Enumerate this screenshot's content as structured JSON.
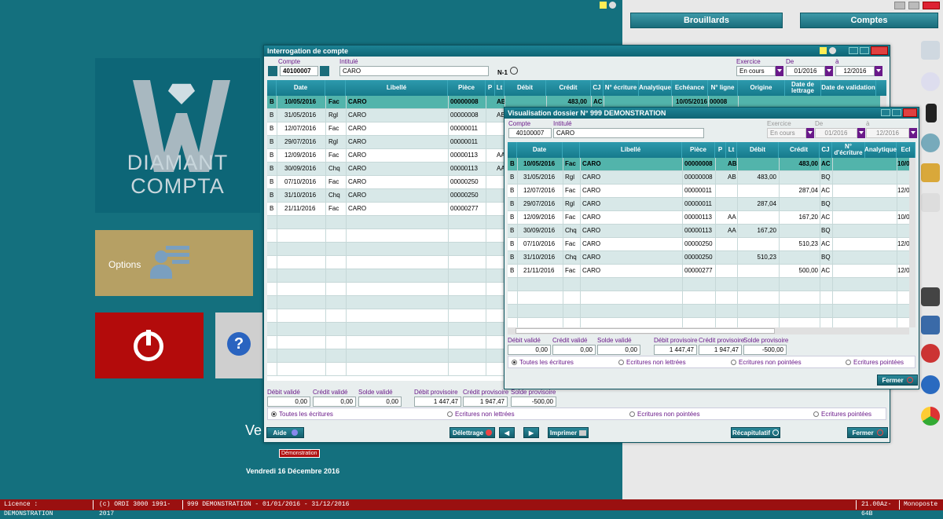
{
  "app": {
    "logo_line1": "DIAMANT",
    "logo_line2": "COMPTA",
    "options_label": "Options",
    "demo_badge": "Démonstration",
    "date_text": "Vendredi 16 Décembre 2016",
    "partial_text": "Ve"
  },
  "right_panel": {
    "brouillards": "Brouillards",
    "comptes": "Comptes"
  },
  "win1": {
    "title": "Interrogation de compte",
    "compte_label": "Compte",
    "compte_value": "40100007",
    "intitule_label": "Intitulé",
    "intitule_value": "CARO",
    "n1_label": "N-1",
    "exercice_label": "Exercice",
    "exercice_value": "En cours",
    "de_label": "De",
    "de_value": "01/2016",
    "a_label": "à",
    "a_value": "12/2016",
    "headers": [
      "Date",
      "Libellé",
      "Pièce",
      "P",
      "Lt",
      "Débit",
      "Crédit",
      "CJ",
      "N° écriture",
      "Analytique",
      "Echéance",
      "N° ligne",
      "Origine",
      "Date de lettrage",
      "Date de validation"
    ],
    "rows": [
      [
        "B",
        "10/05/2016",
        "Fac",
        "CARO",
        "00000008",
        "AB",
        "",
        "483,00",
        "AC",
        "",
        "10/05/2016",
        "00008"
      ],
      [
        "B",
        "31/05/2016",
        "Rgl",
        "CARO",
        "00000008",
        "AB",
        "",
        "",
        "",
        "",
        "",
        ""
      ],
      [
        "B",
        "12/07/2016",
        "Fac",
        "CARO",
        "00000011",
        "",
        "",
        "",
        "",
        "",
        "",
        ""
      ],
      [
        "B",
        "29/07/2016",
        "Rgl",
        "CARO",
        "00000011",
        "",
        "",
        "",
        "",
        "",
        "",
        ""
      ],
      [
        "B",
        "12/09/2016",
        "Fac",
        "CARO",
        "00000113",
        "AA",
        "",
        "",
        "",
        "",
        "",
        ""
      ],
      [
        "B",
        "30/09/2016",
        "Chq",
        "CARO",
        "00000113",
        "AA",
        "",
        "",
        "",
        "",
        "",
        ""
      ],
      [
        "B",
        "07/10/2016",
        "Fac",
        "CARO",
        "00000250",
        "",
        "",
        "",
        "",
        "",
        "",
        ""
      ],
      [
        "B",
        "31/10/2016",
        "Chq",
        "CARO",
        "00000250",
        "",
        "",
        "",
        "",
        "",
        "",
        ""
      ],
      [
        "B",
        "21/11/2016",
        "Fac",
        "CARO",
        "00000277",
        "",
        "",
        "",
        "",
        "",
        "",
        ""
      ]
    ],
    "totals": {
      "debit_valide_label": "Débit validé",
      "debit_valide": "0,00",
      "credit_valide_label": "Crédit validé",
      "credit_valide": "0,00",
      "solde_valide_label": "Solde validé",
      "solde_valide": "0,00",
      "debit_prov_label": "Débit provisoire",
      "debit_prov": "1 447,47",
      "credit_prov_label": "Crédit provisoire",
      "credit_prov": "1 947,47",
      "solde_prov_label": "Solde provisoire",
      "solde_prov": "-500,00"
    },
    "radios": [
      "Toutes les écritures",
      "Ecritures non lettrées",
      "Ecritures non pointées",
      "Ecritures  pointées"
    ],
    "buttons": {
      "aide": "Aide",
      "delettrage": "Délettrage",
      "imprimer": "Imprimer",
      "recap": "Récapitulatif",
      "fermer": "Fermer"
    }
  },
  "win2": {
    "title": "Visualisation dossier N° 999 DEMONSTRATION",
    "compte_label": "Compte",
    "compte_value": "40100007",
    "intitule_label": "Intitulé",
    "intitule_value": "CARO",
    "exercice_label": "Exercice",
    "exercice_value": "En cours",
    "de_label": "De",
    "de_value": "01/2016",
    "a_label": "à",
    "a_value": "12/2016",
    "headers": [
      "Date",
      "Libellé",
      "Pièce",
      "P",
      "Lt",
      "Débit",
      "Crédit",
      "CJ",
      "N° d'écriture",
      "Analytique",
      "Ecl"
    ],
    "rows": [
      [
        "B",
        "10/05/2016",
        "Fac",
        "CARO",
        "00000008",
        "AB",
        "",
        "483,00",
        "AC",
        "10/0"
      ],
      [
        "B",
        "31/05/2016",
        "Rgl",
        "CARO",
        "00000008",
        "AB",
        "483,00",
        "",
        "BQ",
        ""
      ],
      [
        "B",
        "12/07/2016",
        "Fac",
        "CARO",
        "00000011",
        "",
        "",
        "287,04",
        "AC",
        "12/0"
      ],
      [
        "B",
        "29/07/2016",
        "Rgl",
        "CARO",
        "00000011",
        "",
        "287,04",
        "",
        "BQ",
        ""
      ],
      [
        "B",
        "12/09/2016",
        "Fac",
        "CARO",
        "00000113",
        "AA",
        "",
        "167,20",
        "AC",
        "10/0"
      ],
      [
        "B",
        "30/09/2016",
        "Chq",
        "CARO",
        "00000113",
        "AA",
        "167,20",
        "",
        "BQ",
        ""
      ],
      [
        "B",
        "07/10/2016",
        "Fac",
        "CARO",
        "00000250",
        "",
        "",
        "510,23",
        "AC",
        "12/0"
      ],
      [
        "B",
        "31/10/2016",
        "Chq",
        "CARO",
        "00000250",
        "",
        "510,23",
        "",
        "BQ",
        ""
      ],
      [
        "B",
        "21/11/2016",
        "Fac",
        "CARO",
        "00000277",
        "",
        "",
        "500,00",
        "AC",
        "12/0"
      ]
    ],
    "totals": {
      "debit_valide_label": "Débit validé",
      "debit_valide": "0,00",
      "credit_valide_label": "Crédit validé",
      "credit_valide": "0,00",
      "solde_valide_label": "Solde validé",
      "solde_valide": "0,00",
      "debit_prov_label": "Débit provisoire",
      "debit_prov": "1 447,47",
      "credit_prov_label": "Crédit provisoire",
      "credit_prov": "1 947,47",
      "solde_prov_label": "Solde provisoire",
      "solde_prov": "-500,00"
    },
    "radios": [
      "Toutes les écritures",
      "Ecritures non lettrées",
      "Ecritures non pointées",
      "Ecritures  pointées"
    ],
    "fermer": "Fermer"
  },
  "statusbar": [
    "Licence : DEMONSTRATION",
    "(c) ORDI 3000 1991-2017",
    "999 DEMONSTRATION - 01/01/2016 - 31/12/2016",
    "21.00Az-64B",
    "Monoposte"
  ]
}
